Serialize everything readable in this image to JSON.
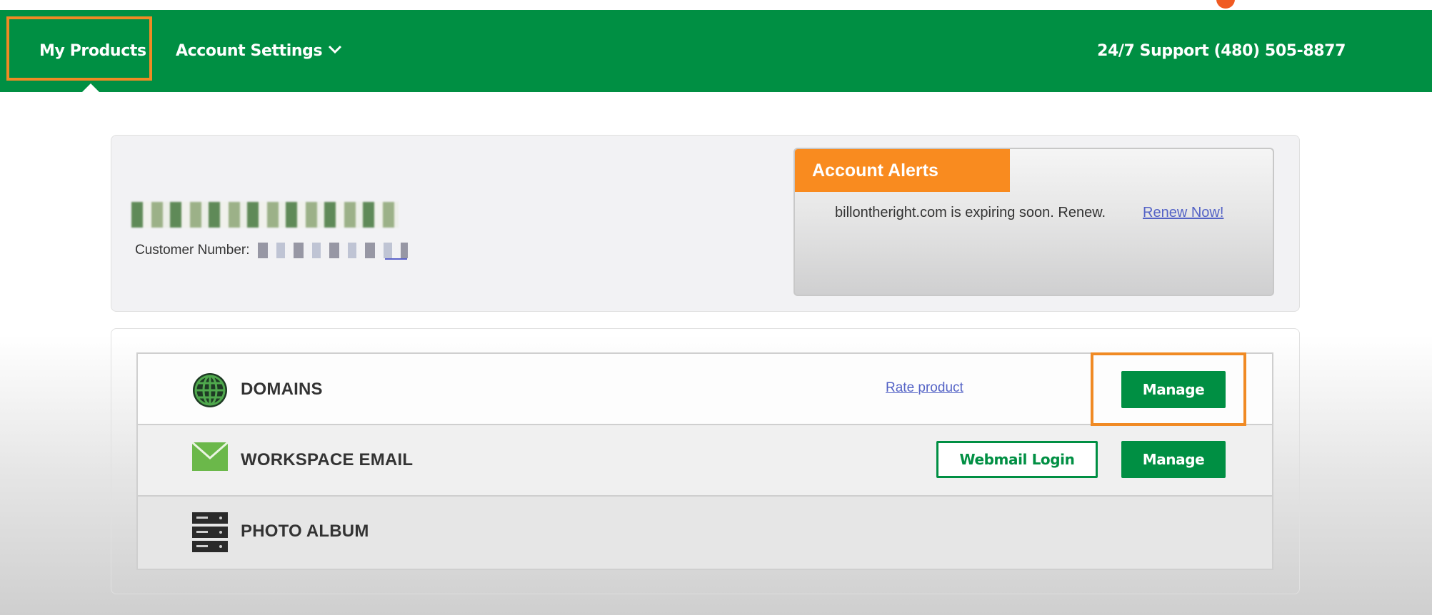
{
  "nav": {
    "my_products": "My Products",
    "account_settings": "Account Settings",
    "support": "24/7 Support (480) 505-8877"
  },
  "account": {
    "customer_number_label": "Customer Number:"
  },
  "alerts": {
    "title": "Account Alerts",
    "message": "billontheright.com is expiring soon. Renew.",
    "renew_link": "Renew Now!"
  },
  "products": [
    {
      "name": "DOMAINS",
      "icon": "globe-icon",
      "rate_link": "Rate product",
      "manage": "Manage"
    },
    {
      "name": "WORKSPACE EMAIL",
      "icon": "envelope-icon",
      "webmail": "Webmail Login",
      "manage": "Manage"
    },
    {
      "name": "PHOTO ALBUM",
      "icon": "server-icon"
    }
  ],
  "colors": {
    "brand_green": "#008f43",
    "alert_orange": "#f98b1f",
    "highlight_orange": "#f08a24",
    "link_blue": "#5463c6"
  }
}
